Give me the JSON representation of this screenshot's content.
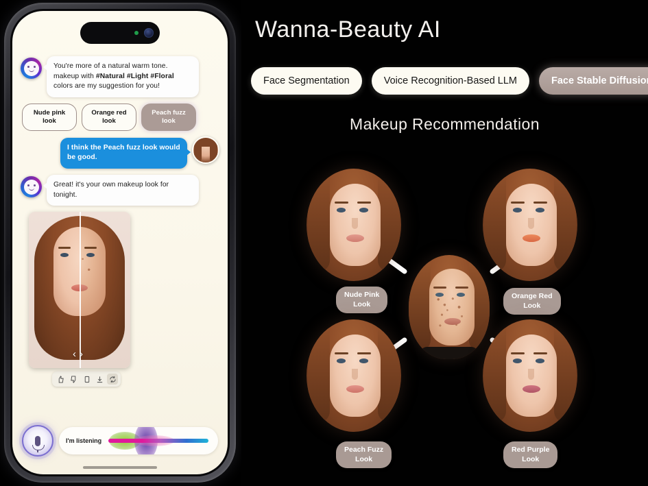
{
  "app": {
    "title": "Wanna-Beauty AI",
    "section_title": "Makeup Recommendation",
    "accent_active": "#a79791",
    "accent_pill": "#fdfbf2",
    "background": "#010101",
    "user_bubble_color": "#1b8fdd"
  },
  "tabs": [
    {
      "label": "Face Segmentation",
      "active": false
    },
    {
      "label": "Voice Recognition-Based LLM",
      "active": false
    },
    {
      "label": "Face Stable Diffusion",
      "active": true
    }
  ],
  "phone": {
    "status": {
      "camera_icon": "front-camera-icon",
      "recording_dot": "green-recording-dot"
    },
    "chat": [
      {
        "sender": "bot",
        "avatar": "bot-avatar-icon",
        "text_part_1": "You're more of a natural warm tone. makeup with ",
        "text_highlight": "#Natural #Light #Floral",
        "text_part_2": " colors are my suggestion for you!"
      },
      {
        "sender": "user",
        "avatar": "user-avatar",
        "text": "I think the Peach fuzz look would be good."
      },
      {
        "sender": "bot",
        "avatar": "bot-avatar-icon",
        "text": "Great! it's your own makeup look for tonight."
      }
    ],
    "look_options": [
      {
        "label": "Nude pink\nlook",
        "selected": false
      },
      {
        "label": "Orange red\nlook",
        "selected": false
      },
      {
        "label": "Peach fuzz\nlook",
        "selected": true
      }
    ],
    "result": {
      "compare_prev": "‹",
      "compare_next": "›",
      "toolbar": [
        {
          "icon": "thumbs-up-icon",
          "active": false
        },
        {
          "icon": "thumbs-down-icon",
          "active": false
        },
        {
          "icon": "copy-icon",
          "active": false
        },
        {
          "icon": "download-icon",
          "active": false
        },
        {
          "icon": "regenerate-icon",
          "active": true
        }
      ]
    },
    "voice": {
      "mic_icon": "microphone-icon",
      "status_text": "I'm listening",
      "waveform_icon": "audio-waveform"
    }
  },
  "recommendation": {
    "center": {
      "label": "original-face"
    },
    "looks": [
      {
        "id": "nude-pink",
        "label": "Nude Pink\nLook",
        "lip_color": "#d98a7e",
        "position": "top-left"
      },
      {
        "id": "orange-red",
        "label": "Orange Red\nLook",
        "lip_color": "#e0744f",
        "position": "top-right"
      },
      {
        "id": "peach-fuzz",
        "label": "Peach Fuzz\nLook",
        "lip_color": "#d98271",
        "position": "bottom-left"
      },
      {
        "id": "red-purple",
        "label": "Red Purple\nLook",
        "lip_color": "#c4636f",
        "position": "bottom-right"
      }
    ]
  }
}
